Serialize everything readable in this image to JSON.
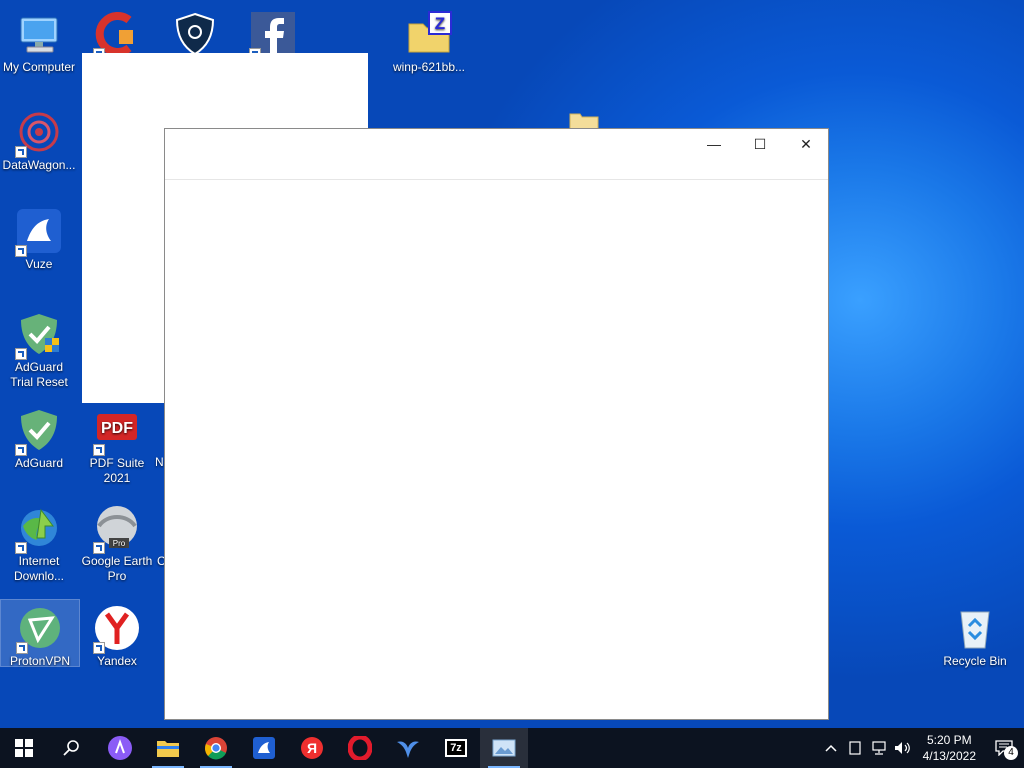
{
  "desktop_icons": {
    "my_computer": "My Computer",
    "datawagon": "DataWagon...",
    "vuze": "Vuze",
    "adguard_trial_reset": "AdGuard Trial Reset",
    "adguard": "AdGuard",
    "pdf_suite": "PDF Suite 2021",
    "internet_download": "Internet Downlo...",
    "google_earth_pro": "Google Earth Pro",
    "protonvpn": "ProtonVPN",
    "yandex": "Yandex",
    "winp_archive": "winp-621bb...",
    "recycle_bin": "Recycle Bin",
    "partial_label_n": "N",
    "partial_label_c": "C"
  },
  "window": {
    "minimize_glyph": "—",
    "maximize_glyph": "☐",
    "close_glyph": "✕"
  },
  "taskbar": {
    "clock_time": "5:20 PM",
    "clock_date": "4/13/2022",
    "notification_count": "4",
    "seven_zip_label": "7z",
    "yandex_letter": "Я"
  },
  "colors": {
    "desktop_blue": "#0a5ad6",
    "taskbar_bg": "#0c1320",
    "accent": "#7ab6ff"
  }
}
